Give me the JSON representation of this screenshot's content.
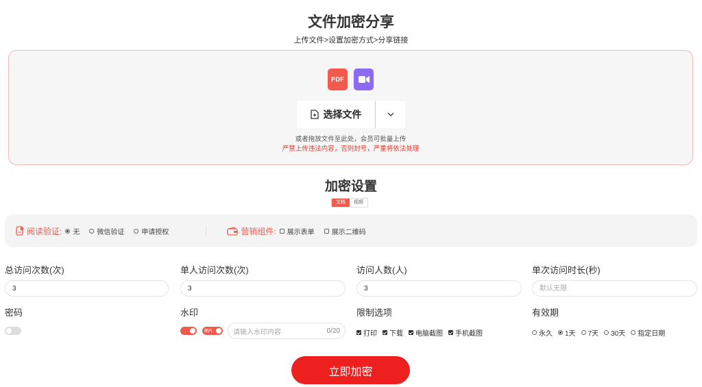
{
  "header": {
    "title": "文件加密分享",
    "steps": "上传文件>设置加密方式>分享链接"
  },
  "upload": {
    "pdf_icon_text": "PDF",
    "select_label": "选择文件",
    "hint": "或者拖放文件至此处，会员可批量上传",
    "warning": "严禁上传违法内容，否则封号，严重将依法处理"
  },
  "settings": {
    "title": "加密设置",
    "tabs": [
      {
        "label": "文档",
        "active": true
      },
      {
        "label": "视频",
        "active": false
      }
    ]
  },
  "verify": {
    "label": "阅读验证:",
    "options": [
      {
        "label": "无",
        "selected": true
      },
      {
        "label": "微信验证",
        "selected": false
      },
      {
        "label": "申请授权",
        "selected": false
      }
    ]
  },
  "marketing": {
    "label": "营销组件:",
    "options": [
      {
        "label": "展示表单",
        "checked": false
      },
      {
        "label": "展示二维码",
        "checked": false
      }
    ]
  },
  "fields": {
    "total_visits": {
      "label": "总访问次数(次)",
      "value": "3"
    },
    "single_visits": {
      "label": "单人访问次数(次)",
      "value": "3"
    },
    "visitors": {
      "label": "访问人数(人)",
      "value": "3"
    },
    "duration": {
      "label": "单次访问时长(秒)",
      "placeholder": "默认无限"
    },
    "password": {
      "label": "密码",
      "enabled": false
    },
    "watermark": {
      "label": "水印",
      "enabled": true,
      "badge": "图片",
      "placeholder": "请输入水印内容",
      "counter": "0/20"
    },
    "restrictions": {
      "label": "限制选项",
      "options": [
        {
          "label": "打印",
          "checked": true
        },
        {
          "label": "下载",
          "checked": true
        },
        {
          "label": "电脑截图",
          "checked": true
        },
        {
          "label": "手机截图",
          "checked": true
        }
      ]
    },
    "validity": {
      "label": "有效期",
      "options": [
        {
          "label": "永久",
          "selected": false
        },
        {
          "label": "1天",
          "selected": true
        },
        {
          "label": "7天",
          "selected": false
        },
        {
          "label": "30天",
          "selected": false
        },
        {
          "label": "指定日期",
          "selected": false
        }
      ]
    }
  },
  "submit_label": "立即加密",
  "colors": {
    "accent": "#f25a4e",
    "submit": "#ee1f1f",
    "border": "#f3b8b3"
  }
}
